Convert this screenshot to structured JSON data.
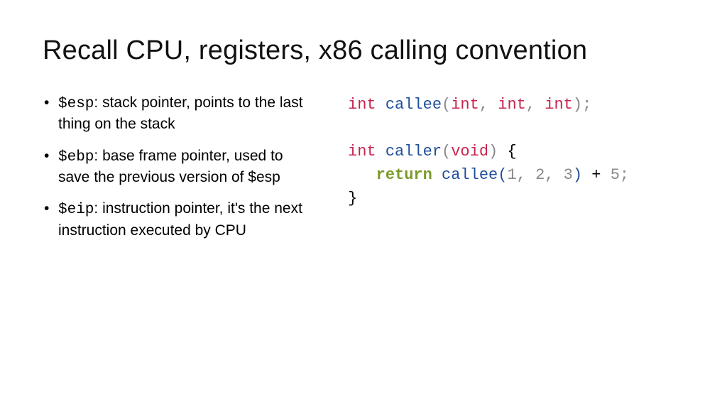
{
  "title": "Recall CPU, registers, x86 calling convention",
  "bullets": [
    {
      "reg": "$esp",
      "desc": ": stack pointer, points to the last thing on the stack"
    },
    {
      "reg": "$ebp",
      "desc": ": base frame pointer, used to save the previous version of $esp"
    },
    {
      "reg": "$eip",
      "desc": ": instruction pointer, it's the next instruction executed by CPU"
    }
  ],
  "code": {
    "l1": {
      "int": "int",
      "sp1": " ",
      "fn": "callee",
      "lp": "(",
      "int_a": "int",
      "c1": ",",
      "sp2": " ",
      "int_b": "int",
      "c2": ",",
      "sp3": " ",
      "int_c": "int",
      "rp": ")",
      "sc": ";"
    },
    "l2": "",
    "l3": {
      "int": "int",
      "sp1": " ",
      "fn": "caller",
      "lp": "(",
      "void": "void",
      "rp": ")",
      "sp2": " ",
      "brace": "{"
    },
    "l4": {
      "indent": "   ",
      "ret": "return",
      "sp1": " ",
      "fn": "callee(",
      "n1": "1",
      "c1": ",",
      "sp2": " ",
      "n2": "2",
      "c2": ",",
      "sp3": " ",
      "n3": "3",
      "rp": ")",
      "sp4": " ",
      "plus": "+",
      "sp5": " ",
      "n5": "5",
      "sc": ";"
    },
    "l5": {
      "brace": "}"
    }
  }
}
